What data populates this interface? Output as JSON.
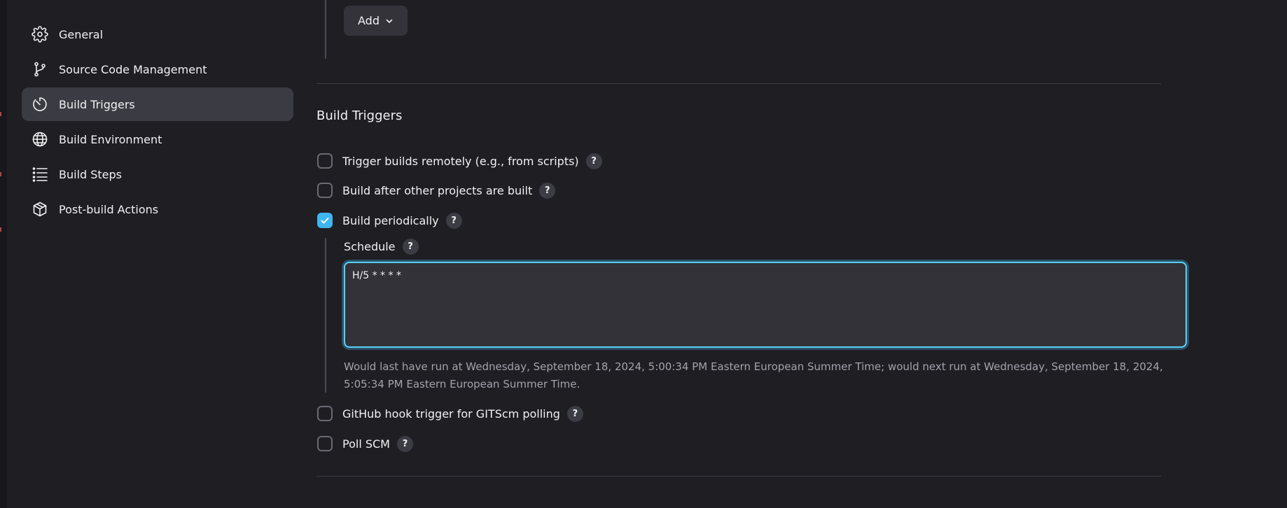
{
  "sidebar": {
    "items": [
      {
        "label": "General",
        "icon": "gear-icon"
      },
      {
        "label": "Source Code Management",
        "icon": "branch-icon"
      },
      {
        "label": "Build Triggers",
        "icon": "timer-icon",
        "active": true
      },
      {
        "label": "Build Environment",
        "icon": "globe-icon"
      },
      {
        "label": "Build Steps",
        "icon": "list-icon"
      },
      {
        "label": "Post-build Actions",
        "icon": "package-icon"
      }
    ]
  },
  "main": {
    "add_button_label": "Add",
    "section_title": "Build Triggers",
    "triggers": [
      {
        "label": "Trigger builds remotely (e.g., from scripts)",
        "checked": false
      },
      {
        "label": "Build after other projects are built",
        "checked": false
      },
      {
        "label": "Build periodically",
        "checked": true
      },
      {
        "label": "GitHub hook trigger for GITScm polling",
        "checked": false
      },
      {
        "label": "Poll SCM",
        "checked": false
      }
    ],
    "help_glyph": "?",
    "schedule": {
      "label": "Schedule",
      "value": "H/5 * * * *",
      "help_text": "Would last have run at Wednesday, September 18, 2024, 5:00:34 PM Eastern European Summer Time; would next run at Wednesday, September 18, 2024, 5:05:34 PM Eastern European Summer Time."
    }
  },
  "colors": {
    "background": "#1f1e23",
    "active_nav": "#3b3b43",
    "accent": "#3fb6ef",
    "focus_border": "#5ccff5",
    "muted_text": "#a3a3ab"
  }
}
